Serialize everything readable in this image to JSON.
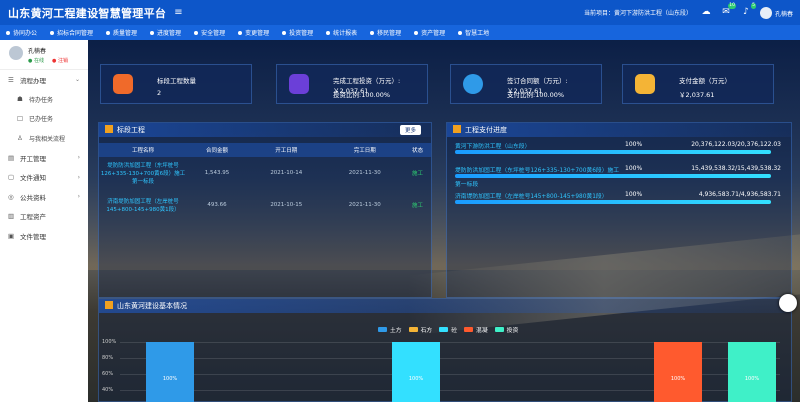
{
  "app_title": "山东黄河工程建设智慧管理平台",
  "current_project_label": "当前项目：黄河下游防洪工程（山东段）",
  "badges": {
    "b1": "10",
    "b2": "5"
  },
  "user_name": "孔楠春",
  "nav": [
    "协同办公",
    "招标合同管理",
    "质量管理",
    "进度管理",
    "安全管理",
    "变更管理",
    "投资管理",
    "统计报表",
    "移民管理",
    "资产管理",
    "智慧工地"
  ],
  "sidebar": {
    "user": "孔楠春",
    "online": "在线",
    "exit": "注销",
    "items": [
      {
        "label": "流程办理",
        "icon": "workflow-icon",
        "open": true
      },
      {
        "label": "待办任务",
        "icon": "todo-icon",
        "sub": true
      },
      {
        "label": "已办任务",
        "icon": "done-icon",
        "sub": true
      },
      {
        "label": "与我相关流程",
        "icon": "related-icon",
        "sub": true
      },
      {
        "label": "开工管理",
        "icon": "start-icon"
      },
      {
        "label": "文件通知",
        "icon": "notice-icon"
      },
      {
        "label": "公共资料",
        "icon": "share-icon"
      },
      {
        "label": "工程资产",
        "icon": "asset-icon"
      },
      {
        "label": "文件管理",
        "icon": "file-icon"
      }
    ]
  },
  "cards": [
    {
      "l1": "标段工程数量",
      "l2": "2",
      "color": "#f06a2a"
    },
    {
      "l1": "完成工程投资（万元）: ￥2,037.61",
      "l2": "投资比例:100.00%",
      "color": "#6b3fd8"
    },
    {
      "l1": "签订合同额（万元）: ￥2,037.61",
      "l2": "支付比例:100.00%",
      "color": "#2f9ae8"
    },
    {
      "l1": "支付金额（万元）",
      "l2": "￥2,037.61",
      "color": "#f4b436"
    }
  ],
  "sections": {
    "tender": "标段工程",
    "more": "更多",
    "pay": "工程支付进度",
    "basic": "山东黄河建设基本情况"
  },
  "tender_table": {
    "headers": [
      "工程名称",
      "合同金额",
      "开工日期",
      "完工日期",
      "状态"
    ],
    "rows": [
      {
        "name": "堤防防洪加固工程（东坪桩号126+335-130+700黄6段）施工第一标段",
        "amount": "1,543.95",
        "start": "2021-10-14",
        "end": "2021-11-30",
        "status": "施工"
      },
      {
        "name": "济南堤防加固工程（左岸桩号145+800-145+980黄1段）",
        "amount": "493.66",
        "start": "2021-10-15",
        "end": "2021-11-30",
        "status": "施工"
      }
    ]
  },
  "pay_progress": [
    {
      "name": "黄河下游防洪工程（山东段）",
      "pct": "100%",
      "value": "20,376,122.03/20,376,122.03",
      "fill": 1.0
    },
    {
      "name": "堤防防洪加固工程（东坪桩号126+335-130+700黄6段）施工",
      "pct": "100%",
      "value": "15,439,538.32/15,439,538.32",
      "fill": 1.0
    },
    {
      "name": "第一标段",
      "pct": "",
      "value": "",
      "fill": 1.0
    },
    {
      "name": "济南堤防加固工程（左岸桩号145+800-145+980黄1段）",
      "pct": "100%",
      "value": "4,936,583.71/4,936,583.71",
      "fill": 1.0
    }
  ],
  "chart_data": {
    "type": "bar",
    "legend": [
      {
        "name": "土方",
        "color": "#2f9ae8"
      },
      {
        "name": "石方",
        "color": "#f4b436"
      },
      {
        "name": "砼",
        "color": "#33e0ff"
      },
      {
        "name": "混凝",
        "color": "#ff5a2e"
      },
      {
        "name": "投资",
        "color": "#3ff0c8"
      }
    ],
    "yticks": [
      "100%",
      "80%",
      "60%",
      "40%"
    ],
    "bars": [
      {
        "series": "土方",
        "value": 100,
        "label": "100%"
      },
      {
        "series": "砼",
        "value": 100,
        "label": "100%"
      },
      {
        "series": "混凝",
        "value": 100,
        "label": "100%"
      },
      {
        "series": "投资",
        "value": 100,
        "label": "100%"
      }
    ]
  }
}
